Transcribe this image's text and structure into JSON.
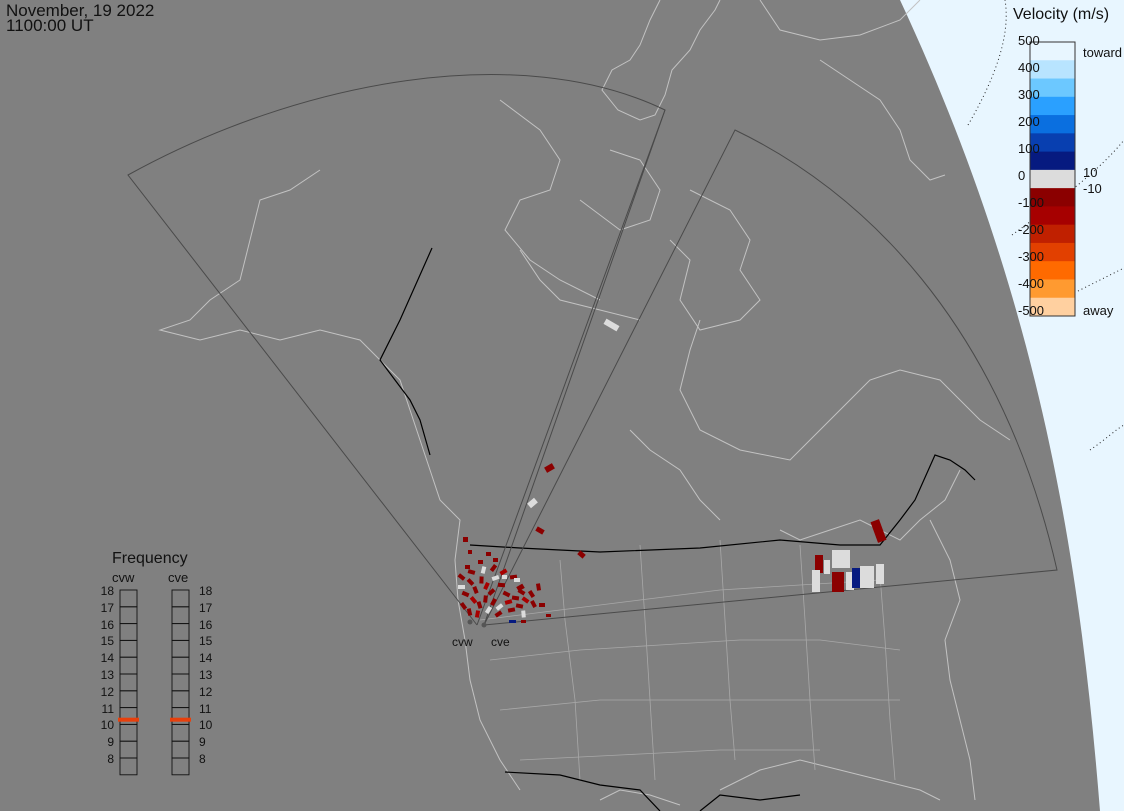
{
  "header": {
    "date": "November, 19 2022",
    "time": "1100:00 UT"
  },
  "velocity_scale": {
    "title": "Velocity (m/s)",
    "ticks": [
      "500",
      "400",
      "300",
      "200",
      "100",
      "0",
      "-100",
      "-200",
      "-300",
      "-400",
      "-500"
    ],
    "toward_label": "toward",
    "away_label": "away",
    "small_ticks": [
      "10",
      "-10"
    ],
    "colors": [
      "#e8f6ff",
      "#b8e4ff",
      "#6cc8ff",
      "#2aa0ff",
      "#0a6fe0",
      "#083fb0",
      "#061a80",
      "#dcdcdc",
      "#8b0000",
      "#a60000",
      "#c02000",
      "#e24000",
      "#ff6a00",
      "#ff9a30",
      "#ffd0a0"
    ]
  },
  "frequency": {
    "title": "Frequency",
    "radars": [
      {
        "name": "cvw",
        "current_mhz": 11
      },
      {
        "name": "cve",
        "current_mhz": 11
      }
    ],
    "levels": [
      "18",
      "17",
      "16",
      "15",
      "14",
      "13",
      "12",
      "11",
      "10",
      "9",
      "8"
    ],
    "indicator_color": "#e8400c"
  },
  "sites": [
    {
      "name": "cvw"
    },
    {
      "name": "cve"
    }
  ],
  "colors": {
    "background": "#808080",
    "coast": "#c2c2c2",
    "border": "#000000",
    "fov": "#4a4a4a",
    "terminator_side": "#e8f6ff"
  }
}
